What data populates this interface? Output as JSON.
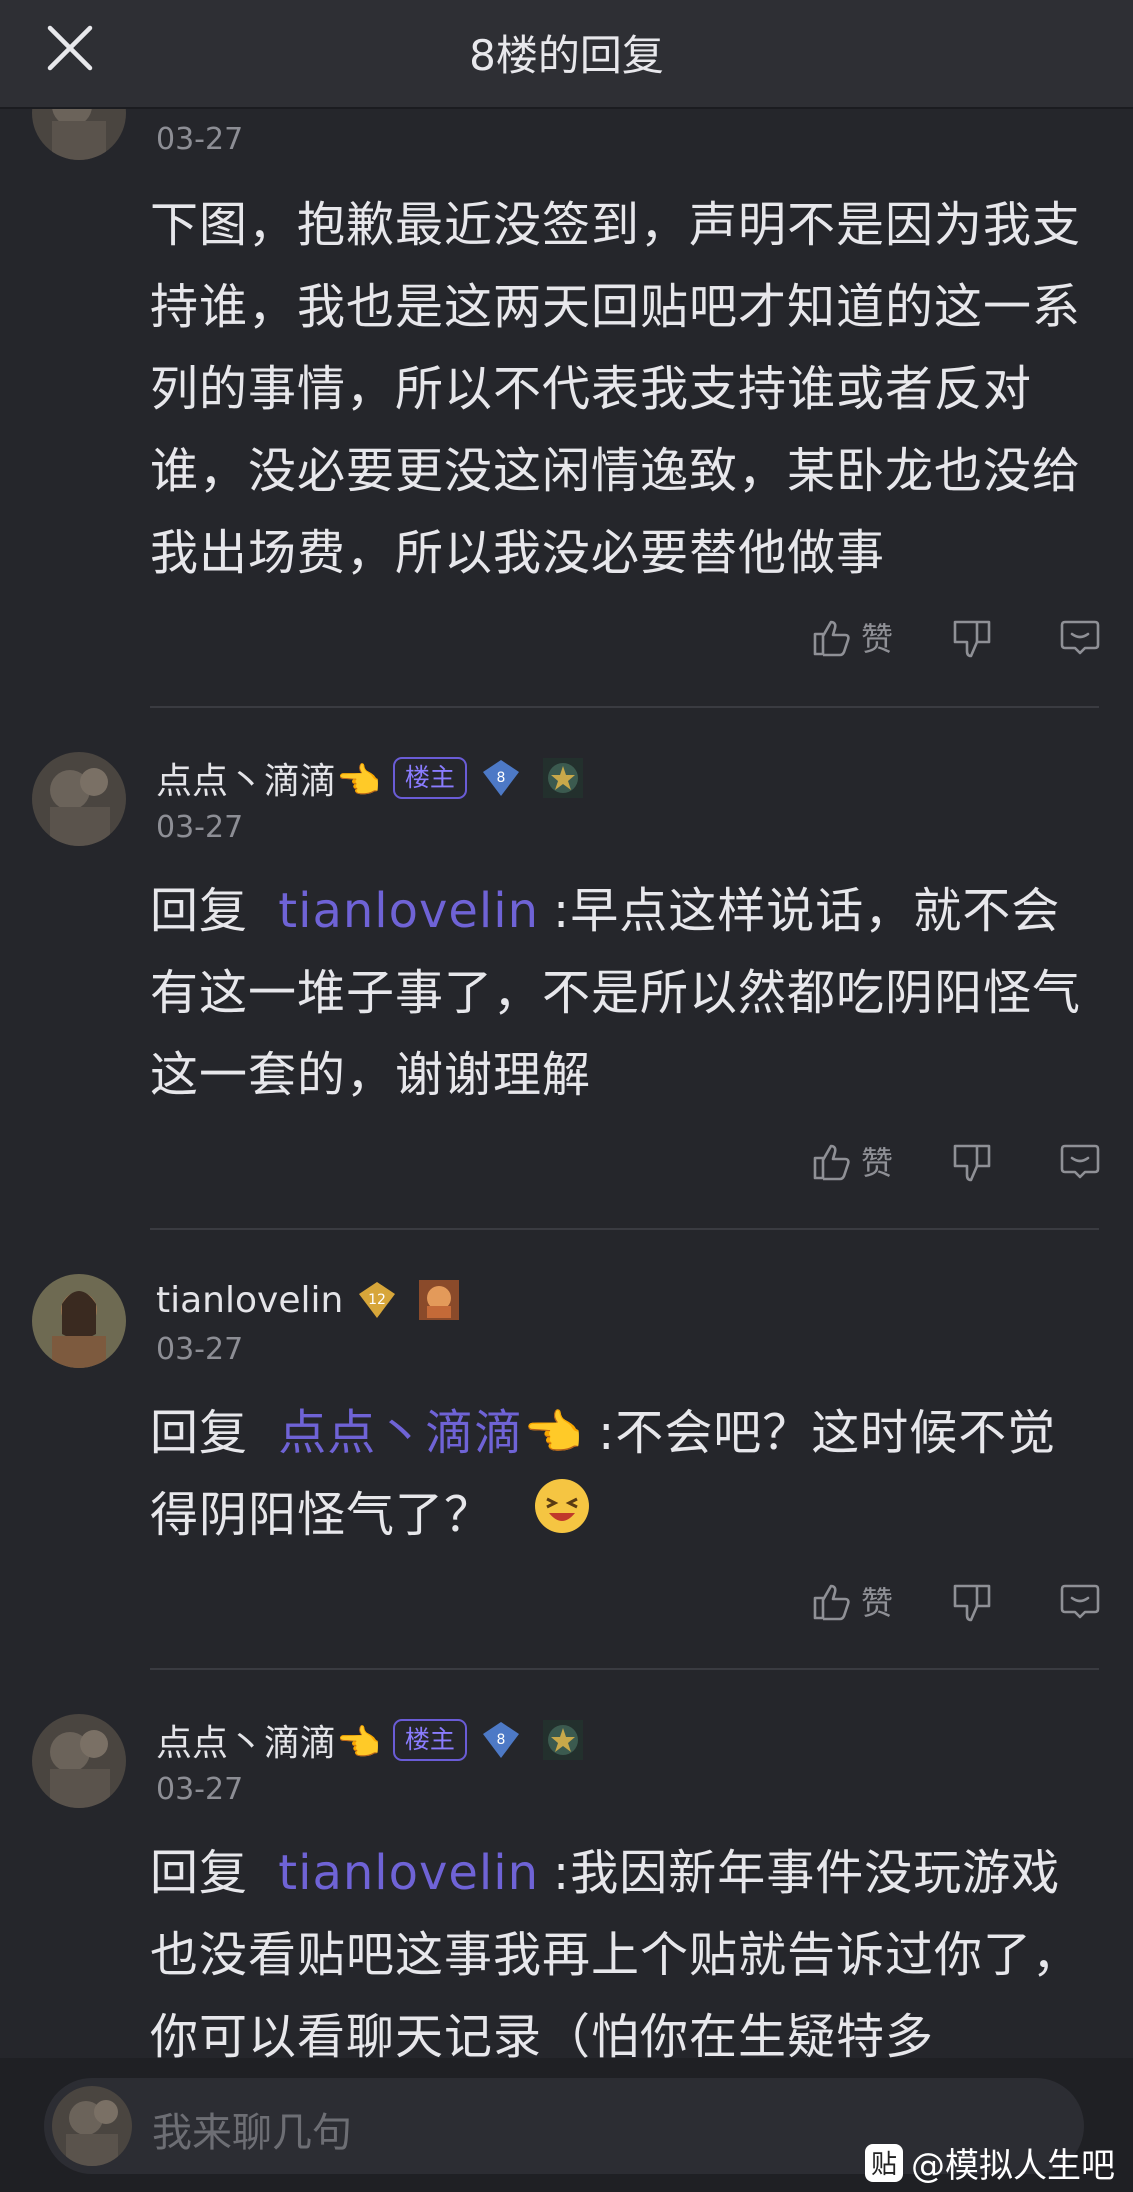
{
  "header": {
    "title": "8楼的回复"
  },
  "replies": [
    {
      "date": "03-27",
      "text": "下图，抱歉最近没签到，声明不是因为我支持谁，我也是这两天回贴吧才知道的这一系列的事情，所以不代表我支持谁或者反对谁，没必要更没这闲情逸致，某卧龙也没给我出场费，所以我没必要替他做事",
      "like_label": "赞"
    },
    {
      "username": "点点丶滴滴👈",
      "badge": "楼主",
      "level": "8",
      "date": "03-27",
      "reply_prefix": "回复",
      "mention": "tianlovelin",
      "text": ":早点这样说话，就不会有这一堆子事了，不是所以然都吃阴阳怪气这一套的，谢谢理解",
      "like_label": "赞"
    },
    {
      "username": "tianlovelin",
      "level": "12",
      "date": "03-27",
      "reply_prefix": "回复",
      "mention": "点点丶滴滴👈",
      "text": ":不会吧？这时候不觉得阴阳怪气了？",
      "like_label": "赞"
    },
    {
      "username": "点点丶滴滴👈",
      "badge": "楼主",
      "level": "8",
      "date": "03-27",
      "reply_prefix": "回复",
      "mention": "tianlovelin",
      "text": ":我因新年事件没玩游戏也没看贴吧这事我再上个贴就告诉过你了，你可以看聊天记录（怕你在生疑特多"
    }
  ],
  "composer": {
    "placeholder": "我来聊几句"
  },
  "watermark": {
    "icon_char": "贴",
    "text": "@模拟人生吧"
  },
  "colors": {
    "accent": "#6f63d6",
    "background": "#25262b"
  }
}
